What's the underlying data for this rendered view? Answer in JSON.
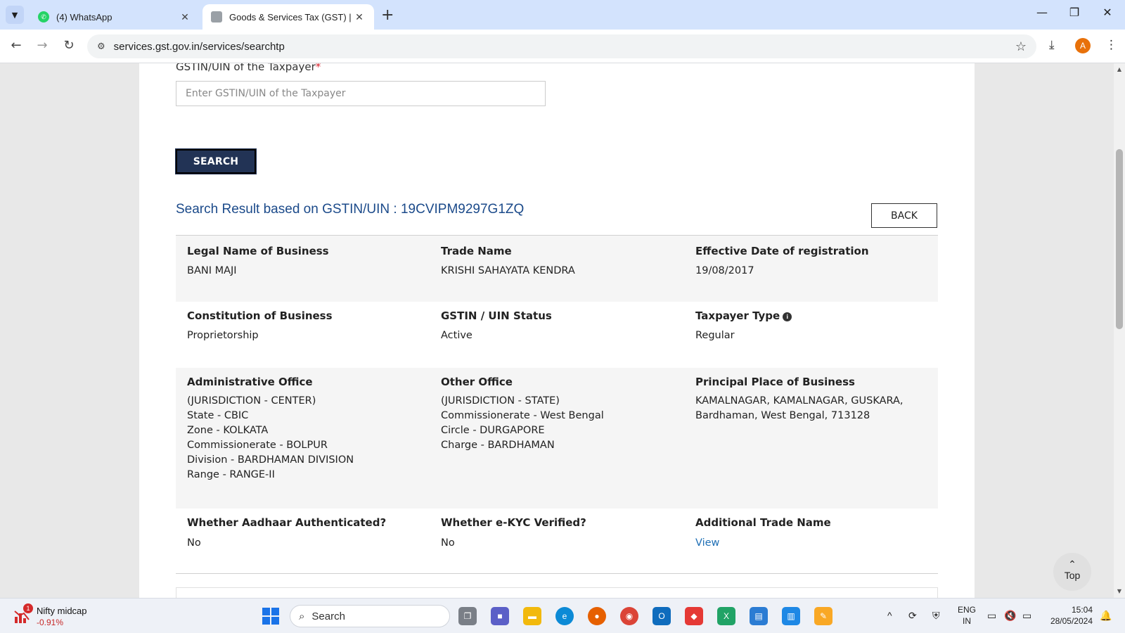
{
  "browser": {
    "tabs": [
      {
        "title": "(4) WhatsApp",
        "active": false
      },
      {
        "title": "Goods & Services Tax (GST) | Se",
        "active": true
      }
    ],
    "url": "services.gst.gov.in/services/searchtp",
    "profile_initial": "A",
    "icons": {
      "tab_menu": "chevron-down-icon",
      "back": "back-arrow-icon",
      "forward": "forward-arrow-icon",
      "reload": "reload-icon",
      "site_info": "site-info-icon",
      "bookmark": "star-icon",
      "download": "download-icon",
      "menu": "kebab-menu-icon"
    }
  },
  "form": {
    "label": "GSTIN/UIN of the Taxpayer",
    "required_mark": "*",
    "placeholder": "Enter GSTIN/UIN of the Taxpayer",
    "value": "",
    "search_label": "SEARCH"
  },
  "result": {
    "title": "Search Result based on GSTIN/UIN : 19CVIPM9297G1ZQ",
    "back_label": "BACK",
    "fields": {
      "legal_name": {
        "label": "Legal Name of Business",
        "value": "BANI MAJI"
      },
      "trade_name": {
        "label": "Trade Name",
        "value": "KRISHI SAHAYATA KENDRA"
      },
      "effective_date": {
        "label": "Effective Date of registration",
        "value": "19/08/2017"
      },
      "constitution": {
        "label": "Constitution of Business",
        "value": "Proprietorship"
      },
      "status": {
        "label": "GSTIN / UIN Status",
        "value": "Active"
      },
      "taxpayer_type": {
        "label": "Taxpayer Type",
        "value": "Regular"
      },
      "admin_office": {
        "label": "Administrative Office",
        "lines": [
          "(JURISDICTION - CENTER)",
          "State - CBIC",
          "Zone - KOLKATA",
          "Commissionerate - BOLPUR",
          "Division - BARDHAMAN DIVISION",
          "Range - RANGE-II"
        ]
      },
      "other_office": {
        "label": "Other Office",
        "lines": [
          "(JURISDICTION - STATE)",
          "Commissionerate - West Bengal",
          "Circle - DURGAPORE",
          "Charge - BARDHAMAN"
        ]
      },
      "principal_place": {
        "label": "Principal Place of Business",
        "lines": [
          "KAMALNAGAR, KAMALNAGAR, GUSKARA,",
          "Bardhaman, West Bengal, 713128"
        ]
      },
      "aadhaar": {
        "label": "Whether Aadhaar Authenticated?",
        "value": "No"
      },
      "ekyc": {
        "label": "Whether e-KYC Verified?",
        "value": "No"
      },
      "additional_trade": {
        "label": "Additional Trade Name",
        "value": "View"
      }
    }
  },
  "scroll_top": {
    "label": "Top"
  },
  "taskbar": {
    "stock_badge": "1",
    "stock_name": "Nifty midcap",
    "stock_change": "-0.91%",
    "search_label": "Search",
    "lang_top": "ENG",
    "lang_bottom": "IN",
    "time": "15:04",
    "date": "28/05/2024"
  },
  "colors": {
    "search_button": "#223355",
    "result_title": "#1b4a8a",
    "link": "#1f6fb5",
    "required": "#d9232e",
    "tabstrip": "#d3e3fd"
  }
}
